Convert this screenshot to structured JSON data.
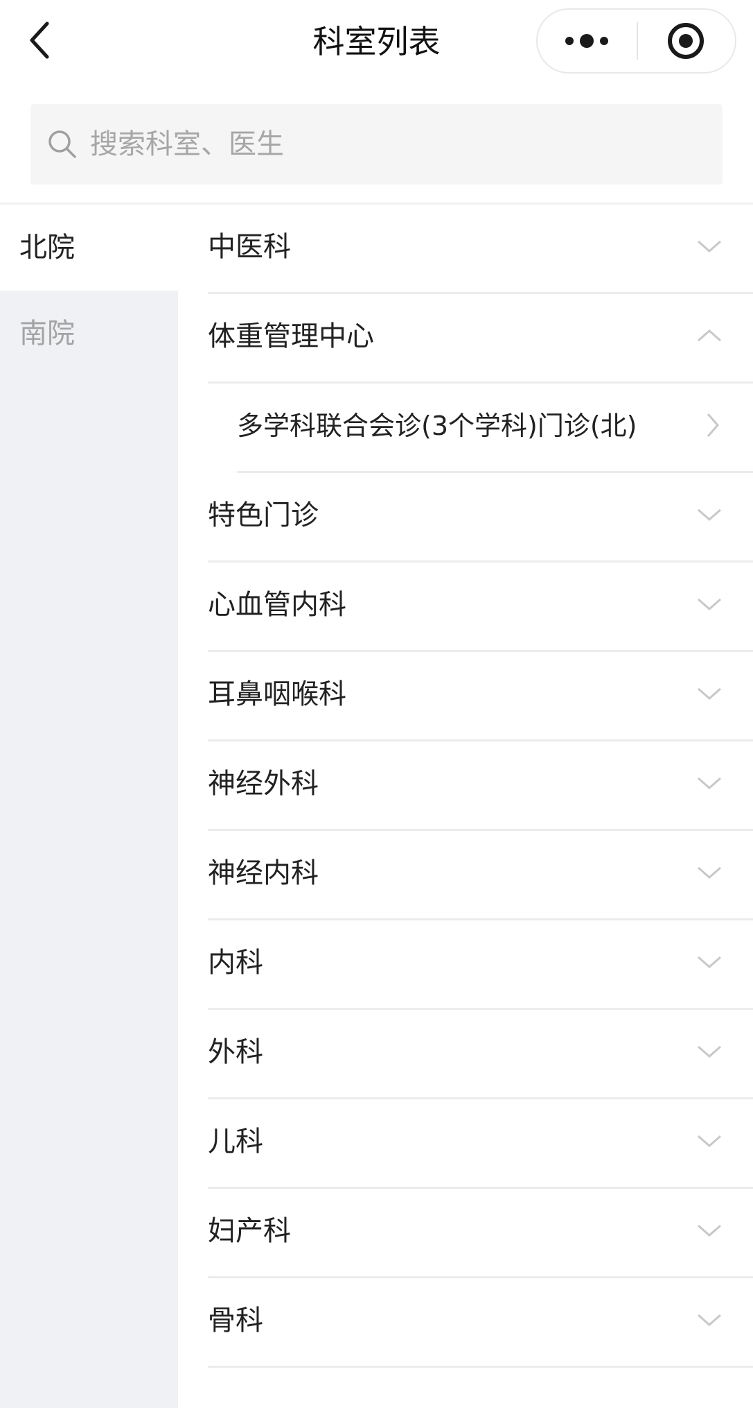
{
  "nav": {
    "title": "科室列表"
  },
  "search": {
    "placeholder": "搜索科室、医生",
    "value": ""
  },
  "sidebar": {
    "items": [
      {
        "label": "北院",
        "active": true
      },
      {
        "label": "南院",
        "active": false
      }
    ]
  },
  "departments": [
    {
      "label": "中医科",
      "state": "collapsed"
    },
    {
      "label": "体重管理中心",
      "state": "expanded"
    },
    {
      "label": "多学科联合会诊(3个学科)门诊(北)",
      "state": "sub-item"
    },
    {
      "label": "特色门诊",
      "state": "collapsed"
    },
    {
      "label": "心血管内科",
      "state": "collapsed"
    },
    {
      "label": "耳鼻咽喉科",
      "state": "collapsed"
    },
    {
      "label": "神经外科",
      "state": "collapsed"
    },
    {
      "label": "神经内科",
      "state": "collapsed"
    },
    {
      "label": "内科",
      "state": "collapsed"
    },
    {
      "label": "外科",
      "state": "collapsed"
    },
    {
      "label": "儿科",
      "state": "collapsed"
    },
    {
      "label": "妇产科",
      "state": "collapsed"
    },
    {
      "label": "骨科",
      "state": "collapsed"
    }
  ],
  "icons": {
    "back": "chevron-left-icon",
    "more": "more-dots-icon",
    "close": "target-circle-icon",
    "search": "search-icon",
    "collapsed": "chevron-down-icon",
    "expanded": "chevron-up-icon",
    "sub-item": "chevron-right-icon"
  },
  "colors": {
    "sidebar_bg": "#f0f1f5",
    "search_bg": "#f5f5f5",
    "text_primary": "#222222",
    "text_muted": "#a3a3a3",
    "separator": "#ececec",
    "chevron": "#c8c8c8"
  }
}
